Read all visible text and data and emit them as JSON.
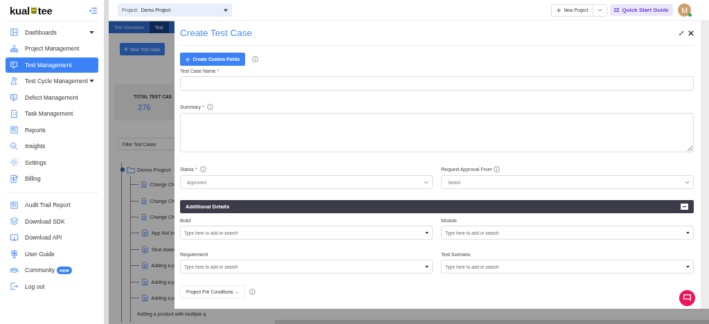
{
  "sidebar": {
    "logo": {
      "left": "kual",
      "right": "tee"
    },
    "groups": [
      {
        "items": [
          {
            "label": "Dashboards",
            "selected": false,
            "expandable": true
          },
          {
            "label": "Project Management",
            "selected": false
          },
          {
            "label": "Test Management",
            "selected": true
          },
          {
            "label": "Test Cycle Management",
            "selected": false,
            "expandable": true
          },
          {
            "label": "Defect Management",
            "selected": false
          },
          {
            "label": "Task Management",
            "selected": false
          },
          {
            "label": "Reports",
            "selected": false
          },
          {
            "label": "Insights",
            "selected": false
          },
          {
            "label": "Settings",
            "selected": false
          },
          {
            "label": "Billing",
            "selected": false
          }
        ]
      },
      {
        "items": [
          {
            "label": "Audit Trail Report",
            "selected": false
          },
          {
            "label": "Download SDK",
            "selected": false
          },
          {
            "label": "Download API",
            "selected": false
          },
          {
            "label": "User Guide",
            "selected": false
          },
          {
            "label": "Community",
            "selected": false,
            "badge": "new"
          },
          {
            "label": "Log out",
            "selected": false
          }
        ]
      }
    ]
  },
  "topbar": {
    "project": {
      "label": "Project:",
      "value": "Demo Project"
    },
    "new_project": "New Project",
    "quick_start": "Quick Start Guide",
    "avatar": {
      "initial": "M",
      "online": true
    }
  },
  "background": {
    "tabs": [
      {
        "label": "Test Scenarios",
        "selected": false
      },
      {
        "label": "Test",
        "selected": true
      }
    ],
    "new_button": "New Test Case",
    "stat": {
      "label": "TOTAL TEST CAS",
      "value": "276"
    },
    "filter": {
      "placeholder": "Filter Test Cases"
    },
    "tree": {
      "label": "Demo Project",
      "expanded": true,
      "children": [
        {
          "label": "Change Ch"
        },
        {
          "label": "Change Ch"
        },
        {
          "label": "Change Ch"
        },
        {
          "label": "App Not In"
        },
        {
          "label": "Shut down"
        },
        {
          "label": "Adding a p"
        },
        {
          "label": "Adding a p"
        },
        {
          "label": "Adding a p"
        },
        {
          "label": "Adding a product with multiple q"
        }
      ]
    }
  },
  "drawer": {
    "title": "Create Test Case",
    "custom_fields_button": "Create Custom Fields",
    "fields": [
      {
        "kind": "text",
        "label": "Test Case Name",
        "mark": "*",
        "info": false
      },
      {
        "kind": "textarea",
        "label": "Summary",
        "mark": "*",
        "info": true
      }
    ],
    "selects": [
      {
        "label": "Status",
        "mark": "*",
        "info": true,
        "value": "Approved"
      },
      {
        "label": "Request Approval From",
        "info": true,
        "value": "Select"
      }
    ],
    "section": {
      "title": "Additional Details",
      "expanded": true
    },
    "combos": [
      {
        "label": "Build",
        "placeholder": "Type here to add or search"
      },
      {
        "label": "Module",
        "placeholder": "Type here to add or search"
      },
      {
        "label": "Requirement",
        "placeholder": "Type here to add or search"
      },
      {
        "label": "Test Scenario",
        "placeholder": "Type here to add or search"
      }
    ],
    "pre_conditions_button": "Project Pre Conditions →"
  }
}
